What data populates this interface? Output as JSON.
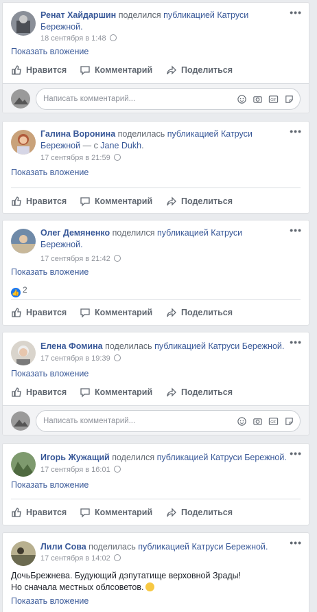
{
  "common": {
    "like_label": "Нравится",
    "comment_label": "Комментарий",
    "share_label": "Поделиться",
    "show_attachment": "Показать вложение",
    "comment_placeholder": "Написать комментарий...",
    "gif_label": "GIF",
    "menu_glyph": "•••"
  },
  "posts": [
    {
      "author": "Ренат Хайдаршин",
      "verb": "поделился",
      "object_prefix": "публикацией",
      "object_owner": "Катруси Бережной",
      "with_prefix": "",
      "with_name": "",
      "time": "18 сентября в 1:48",
      "text": "",
      "likes": ""
    },
    {
      "author": "Галина Воронина",
      "verb": "поделилась",
      "object_prefix": "публикацией",
      "object_owner": "Катруси Бережной",
      "with_prefix": " — с ",
      "with_name": "Jane Dukh",
      "time": "17 сентября в 21:59",
      "text": "",
      "likes": ""
    },
    {
      "author": "Олег Демяненко",
      "verb": "поделился",
      "object_prefix": "публикацией",
      "object_owner": "Катруси Бережной",
      "with_prefix": "",
      "with_name": "",
      "time": "17 сентября в 21:42",
      "text": "",
      "likes": "2"
    },
    {
      "author": "Елена Фомина",
      "verb": "поделилась",
      "object_prefix": "публикацией",
      "object_owner": "Катруси Бережной",
      "with_prefix": "",
      "with_name": "",
      "time": "17 сентября в 19:39",
      "text": "",
      "likes": ""
    },
    {
      "author": "Игорь Жужащий",
      "verb": "поделился",
      "object_prefix": "публикацией",
      "object_owner": "Катруси Бережной",
      "with_prefix": "",
      "with_name": "",
      "time": "17 сентября в 16:01",
      "text": "",
      "likes": ""
    },
    {
      "author": "Лили Сова",
      "verb": "поделилась",
      "object_prefix": "публикацией",
      "object_owner": "Катруси Бережной",
      "with_prefix": "",
      "with_name": "",
      "time": "17 сентября в 14:02",
      "text_line1": "ДочьБрежнева. Будующий дэпутатище верховной Зрады!",
      "text_line2": "Но сначала местных облсоветов.",
      "likes": ""
    }
  ],
  "colors": {
    "link": "#385898",
    "meta": "#90949c",
    "background": "#e9ebee",
    "like_blue": "#1877f2"
  },
  "icons": [
    "thumbs-up-icon",
    "comment-bubble-icon",
    "share-arrow-icon",
    "globe-icon",
    "more-options-icon",
    "emoji-icon",
    "camera-icon",
    "gif-icon",
    "sticker-icon",
    "like-reaction-icon",
    "smile-emoji-icon"
  ]
}
